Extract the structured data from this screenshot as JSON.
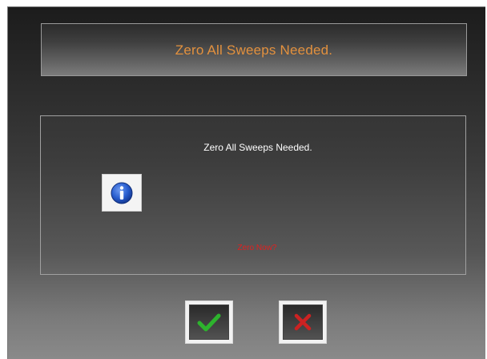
{
  "dialog": {
    "title": "Zero All Sweeps Needed.",
    "message": "Zero All Sweeps Needed.",
    "prompt": "Zero Now?",
    "icon": "info-icon",
    "buttons": {
      "ok": {
        "icon": "checkmark-icon",
        "color": "#2db32d"
      },
      "cancel": {
        "icon": "x-icon",
        "color": "#cc2222"
      }
    }
  },
  "colors": {
    "title_text": "#e3913e",
    "message_text": "#ffffff",
    "prompt_text": "#e02020",
    "info_icon": "#1f56c6"
  }
}
